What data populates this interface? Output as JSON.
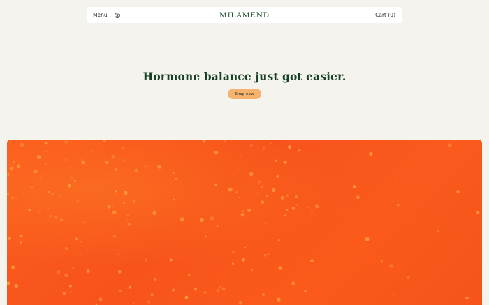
{
  "header": {
    "menu_label": "Menu",
    "account_icon": "user-circle-icon",
    "brand": "MILAMEND",
    "cart_label": "Cart (0)"
  },
  "hero": {
    "title": "Hormone balance just got easier.",
    "cta_label": "Shop now",
    "cta_color": "#f6b370",
    "image_colors": {
      "base": "#f7531b",
      "bubbles": "#ffa23c"
    }
  },
  "colors": {
    "page_background": "#f4f3ee",
    "nav_background": "#ffffff",
    "brand_green": "#1d4a2c"
  }
}
